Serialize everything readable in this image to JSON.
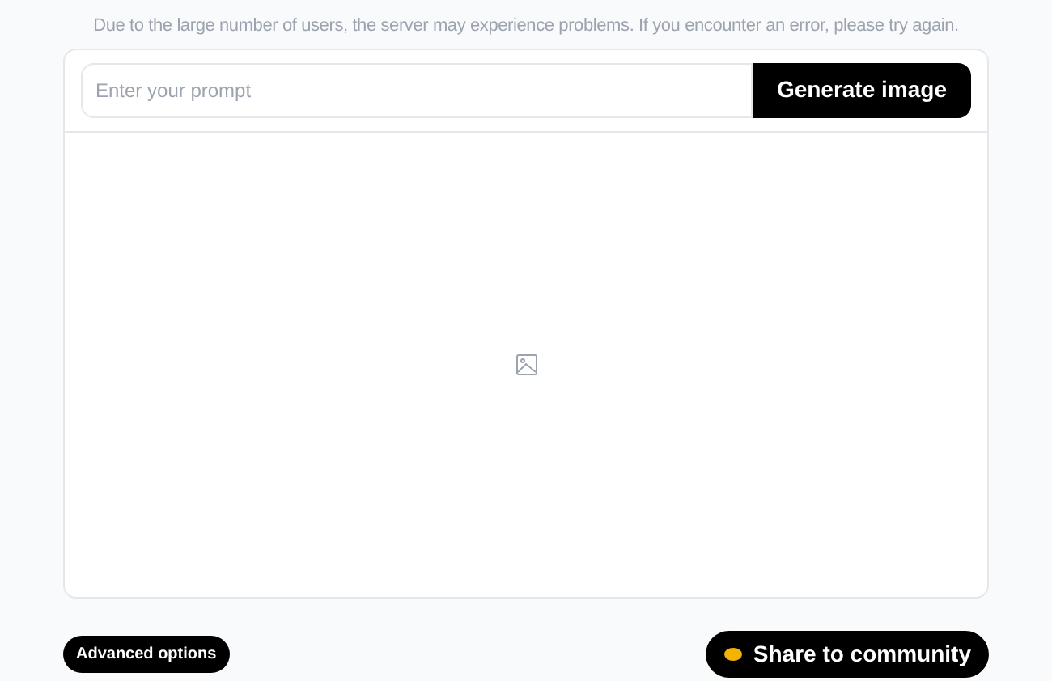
{
  "notice": "Due to the large number of users, the server may experience problems. If you encounter an error, please try again.",
  "prompt": {
    "placeholder": "Enter your prompt"
  },
  "generate_button": "Generate image",
  "advanced_button": "Advanced options",
  "share_button": "Share to community"
}
